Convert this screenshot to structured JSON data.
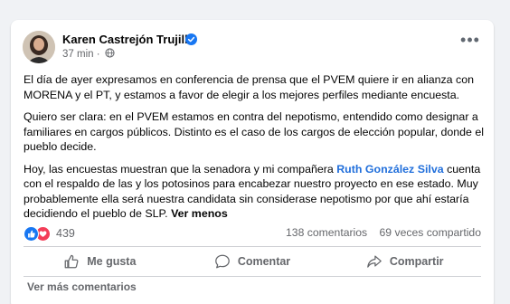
{
  "post": {
    "author": "Karen Castrejón Trujillo",
    "time": "37 min",
    "separator": "·",
    "paragraphs": {
      "p1": "El día de ayer expresamos en conferencia de prensa que el PVEM quiere ir en alianza con MORENA y el PT, y estamos a favor de elegir a los mejores perfiles mediante encuesta.",
      "p2": "Quiero ser clara: en el PVEM estamos en contra del nepotismo, entendido como designar a familiares en cargos públicos. Distinto es el caso de los cargos de elección popular, donde el pueblo decide.",
      "p3_before": "Hoy, las encuestas muestran que la senadora y mi compañera ",
      "p3_mention": "Ruth González Silva",
      "p3_after": " cuenta con el respaldo de las y los potosinos para encabezar nuestro proyecto en ese estado. Muy probablemente ella será nuestra candidata sin considerase nepotismo por que ahí estaría decidiendo el pueblo de SLP.",
      "see_less": "Ver menos"
    },
    "reactions_count": "439",
    "comments": "138 comentarios",
    "shares": "69 veces compartido"
  },
  "actions": {
    "like": "Me gusta",
    "comment": "Comentar",
    "share": "Compartir"
  },
  "more_comments": "Ver más comentarios",
  "icons": {
    "verified": "verified-badge-icon",
    "globe": "globe-icon",
    "more": "more-options-icon",
    "like_reaction": "like-reaction-icon",
    "love_reaction": "love-reaction-icon",
    "like": "thumbs-up-icon",
    "comment": "comment-bubble-icon",
    "share": "share-arrow-icon"
  },
  "colors": {
    "accent": "#1877f2",
    "love": "#f33e58",
    "mention": "#216fdb",
    "secondary_text": "#65676b",
    "page_background": "#f0f2f5"
  }
}
